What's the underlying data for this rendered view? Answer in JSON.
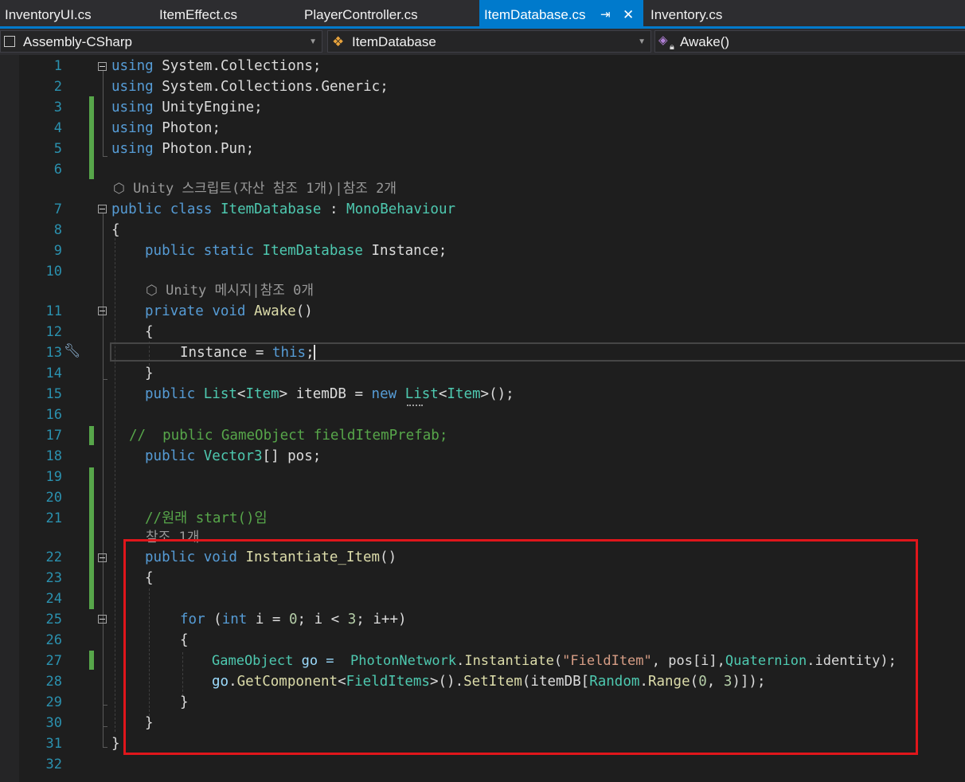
{
  "tabs": [
    {
      "label": "InventoryUI.cs"
    },
    {
      "label": "ItemEffect.cs"
    },
    {
      "label": "PlayerController.cs"
    },
    {
      "label": "ItemDatabase.cs",
      "active": true,
      "pin_icon": "⇥",
      "close_icon": "✕"
    },
    {
      "label": "Inventory.cs"
    }
  ],
  "nav": {
    "project": "Assembly-CSharp",
    "class": "ItemDatabase",
    "member": "Awake()"
  },
  "line_numbers": [
    "1",
    "2",
    "3",
    "4",
    "5",
    "6",
    "7",
    "8",
    "9",
    "10",
    "11",
    "12",
    "13",
    "14",
    "15",
    "16",
    "17",
    "18",
    "19",
    "20",
    "21",
    "22",
    "23",
    "24",
    "25",
    "26",
    "27",
    "28",
    "29",
    "30",
    "31",
    "32"
  ],
  "codelens": {
    "class": "Unity 스크립트(자산 참조 1개)|참조 2개",
    "awake": "Unity 메시지|참조 0개",
    "instantiate": "참조 1개"
  },
  "code": {
    "l1": [
      "using",
      " System",
      ".",
      "Collections",
      ";"
    ],
    "l2": [
      "using",
      " System",
      ".",
      "Collections",
      ".",
      "Generic",
      ";"
    ],
    "l3": [
      "using",
      " UnityEngine",
      ";"
    ],
    "l4": [
      "using",
      " Photon",
      ";"
    ],
    "l5": [
      "using",
      " Photon",
      ".",
      "Pun",
      ";"
    ],
    "l7": [
      "public",
      " ",
      "class",
      " ",
      "ItemDatabase",
      " : ",
      "MonoBehaviour"
    ],
    "l8": [
      "{"
    ],
    "l9": [
      "public",
      " ",
      "static",
      " ",
      "ItemDatabase",
      " Instance;"
    ],
    "l11": [
      "private",
      " ",
      "void",
      " ",
      "Awake",
      "()"
    ],
    "l12": [
      "{"
    ],
    "l13": [
      "Instance = ",
      "this",
      ";"
    ],
    "l14": [
      "}"
    ],
    "l15": [
      "public",
      " ",
      "List",
      "<",
      "Item",
      "> itemDB = ",
      "new",
      " ",
      "List",
      "<",
      "Item",
      ">();"
    ],
    "l17": [
      "//  public GameObject fieldItemPrefab;"
    ],
    "l18": [
      "public",
      " ",
      "Vector3",
      "[] pos;"
    ],
    "l21": [
      "//원래 start()임"
    ],
    "l22": [
      "public",
      " ",
      "void",
      " ",
      "Instantiate_Item",
      "()"
    ],
    "l23": [
      "{"
    ],
    "l25": [
      "for",
      " (",
      "int",
      " i = ",
      "0",
      "; i < ",
      "3",
      "; i++)"
    ],
    "l26": [
      "{"
    ],
    "l27": [
      "GameObject",
      " go =  ",
      "PhotonNetwork",
      ".",
      "Instantiate",
      "(",
      "\"FieldItem\"",
      ", pos[i],",
      "Quaternion",
      ".",
      "identity",
      ");"
    ],
    "l28": [
      "go",
      ".",
      "GetComponent",
      "<",
      "FieldItems",
      ">().",
      "SetItem",
      "(itemDB[",
      "Random",
      ".",
      "Range",
      "(",
      "0",
      ", ",
      "3",
      ")]);"
    ],
    "l29": [
      "}"
    ],
    "l30": [
      "}"
    ],
    "l31": [
      "}"
    ]
  },
  "colors": {
    "keyword": "#569cd6",
    "type": "#4ec9b0",
    "string": "#d69d85",
    "comment": "#57a64a",
    "accent": "#007acc",
    "highlight_box": "#e0161b"
  }
}
